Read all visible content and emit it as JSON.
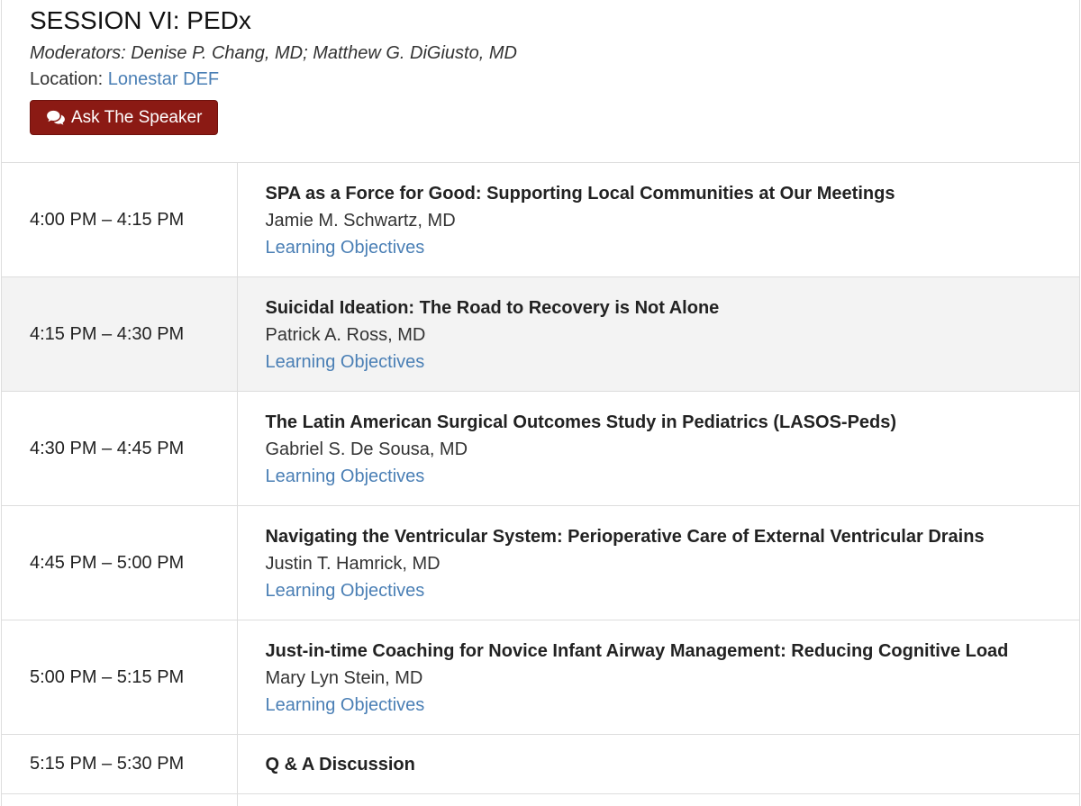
{
  "session": {
    "title": "SESSION VI: PEDx",
    "moderators": "Moderators: Denise P. Chang, MD; Matthew G. DiGiusto, MD",
    "location_label": "Location:",
    "location_value": "Lonestar DEF",
    "ask_button_label": "Ask The Speaker",
    "ask_button_icon": "comments-icon"
  },
  "colors": {
    "accent_link": "#4a7fb5",
    "button_bg": "#8b1a14",
    "alt_row_bg": "#f3f3f3"
  },
  "schedule": [
    {
      "time": "4:00 PM – 4:15 PM",
      "title": "SPA as a Force for Good: Supporting Local Communities at Our Meetings",
      "speaker": "Jamie M. Schwartz, MD",
      "objectives": "Learning Objectives"
    },
    {
      "time": "4:15 PM – 4:30 PM",
      "title": "Suicidal Ideation: The Road to Recovery is Not Alone",
      "speaker": "Patrick A. Ross, MD",
      "objectives": "Learning Objectives"
    },
    {
      "time": "4:30 PM – 4:45 PM",
      "title": "The Latin American Surgical Outcomes Study in Pediatrics (LASOS-Peds)",
      "speaker": "Gabriel S. De Sousa, MD",
      "objectives": "Learning Objectives"
    },
    {
      "time": "4:45 PM – 5:00 PM",
      "title": "Navigating the Ventricular System: Perioperative Care of External Ventricular Drains",
      "speaker": "Justin T. Hamrick, MD",
      "objectives": "Learning Objectives"
    },
    {
      "time": "5:00 PM – 5:15 PM",
      "title": "Just-in-time Coaching for Novice Infant Airway Management: Reducing Cognitive Load",
      "speaker": "Mary Lyn Stein, MD",
      "objectives": "Learning Objectives"
    },
    {
      "time": "5:15 PM – 5:30 PM",
      "title": "Q & A Discussion"
    }
  ]
}
